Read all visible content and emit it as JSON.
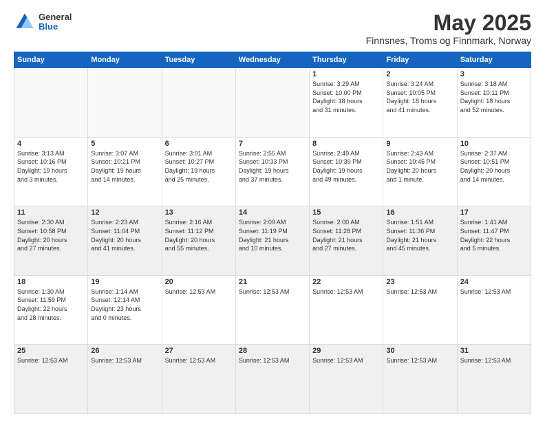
{
  "logo": {
    "general": "General",
    "blue": "Blue"
  },
  "header": {
    "title": "May 2025",
    "subtitle": "Finnsnes, Troms og Finnmark, Norway"
  },
  "weekdays": [
    "Sunday",
    "Monday",
    "Tuesday",
    "Wednesday",
    "Thursday",
    "Friday",
    "Saturday"
  ],
  "weeks": [
    [
      {
        "num": "",
        "info": "",
        "empty": true
      },
      {
        "num": "",
        "info": "",
        "empty": true
      },
      {
        "num": "",
        "info": "",
        "empty": true
      },
      {
        "num": "",
        "info": "",
        "empty": true
      },
      {
        "num": "1",
        "info": "Sunrise: 3:29 AM\nSunset: 10:00 PM\nDaylight: 18 hours\nand 31 minutes."
      },
      {
        "num": "2",
        "info": "Sunrise: 3:24 AM\nSunset: 10:05 PM\nDaylight: 18 hours\nand 41 minutes."
      },
      {
        "num": "3",
        "info": "Sunrise: 3:18 AM\nSunset: 10:11 PM\nDaylight: 18 hours\nand 52 minutes."
      }
    ],
    [
      {
        "num": "4",
        "info": "Sunrise: 3:13 AM\nSunset: 10:16 PM\nDaylight: 19 hours\nand 3 minutes."
      },
      {
        "num": "5",
        "info": "Sunrise: 3:07 AM\nSunset: 10:21 PM\nDaylight: 19 hours\nand 14 minutes."
      },
      {
        "num": "6",
        "info": "Sunrise: 3:01 AM\nSunset: 10:27 PM\nDaylight: 19 hours\nand 25 minutes."
      },
      {
        "num": "7",
        "info": "Sunrise: 2:55 AM\nSunset: 10:33 PM\nDaylight: 19 hours\nand 37 minutes."
      },
      {
        "num": "8",
        "info": "Sunrise: 2:49 AM\nSunset: 10:39 PM\nDaylight: 19 hours\nand 49 minutes."
      },
      {
        "num": "9",
        "info": "Sunrise: 2:43 AM\nSunset: 10:45 PM\nDaylight: 20 hours\nand 1 minute."
      },
      {
        "num": "10",
        "info": "Sunrise: 2:37 AM\nSunset: 10:51 PM\nDaylight: 20 hours\nand 14 minutes."
      }
    ],
    [
      {
        "num": "11",
        "info": "Sunrise: 2:30 AM\nSunset: 10:58 PM\nDaylight: 20 hours\nand 27 minutes."
      },
      {
        "num": "12",
        "info": "Sunrise: 2:23 AM\nSunset: 11:04 PM\nDaylight: 20 hours\nand 41 minutes."
      },
      {
        "num": "13",
        "info": "Sunrise: 2:16 AM\nSunset: 11:12 PM\nDaylight: 20 hours\nand 55 minutes."
      },
      {
        "num": "14",
        "info": "Sunrise: 2:09 AM\nSunset: 11:19 PM\nDaylight: 21 hours\nand 10 minutes."
      },
      {
        "num": "15",
        "info": "Sunrise: 2:00 AM\nSunset: 11:28 PM\nDaylight: 21 hours\nand 27 minutes."
      },
      {
        "num": "16",
        "info": "Sunrise: 1:51 AM\nSunset: 11:36 PM\nDaylight: 21 hours\nand 45 minutes."
      },
      {
        "num": "17",
        "info": "Sunrise: 1:41 AM\nSunset: 11:47 PM\nDaylight: 22 hours\nand 5 minutes."
      }
    ],
    [
      {
        "num": "18",
        "info": "Sunrise: 1:30 AM\nSunset: 11:59 PM\nDaylight: 22 hours\nand 28 minutes."
      },
      {
        "num": "19",
        "info": "Sunrise: 1:14 AM\nSunset: 12:14 AM\nDaylight: 23 hours\nand 0 minutes."
      },
      {
        "num": "20",
        "info": "Sunrise: 12:53 AM"
      },
      {
        "num": "21",
        "info": "Sunrise: 12:53 AM"
      },
      {
        "num": "22",
        "info": "Sunrise: 12:53 AM"
      },
      {
        "num": "23",
        "info": "Sunrise: 12:53 AM"
      },
      {
        "num": "24",
        "info": "Sunrise: 12:53 AM"
      }
    ],
    [
      {
        "num": "25",
        "info": "Sunrise: 12:53 AM"
      },
      {
        "num": "26",
        "info": "Sunrise: 12:53 AM"
      },
      {
        "num": "27",
        "info": "Sunrise: 12:53 AM"
      },
      {
        "num": "28",
        "info": "Sunrise: 12:53 AM"
      },
      {
        "num": "29",
        "info": "Sunrise: 12:53 AM"
      },
      {
        "num": "30",
        "info": "Sunrise: 12:53 AM"
      },
      {
        "num": "31",
        "info": "Sunrise: 12:53 AM"
      }
    ]
  ]
}
